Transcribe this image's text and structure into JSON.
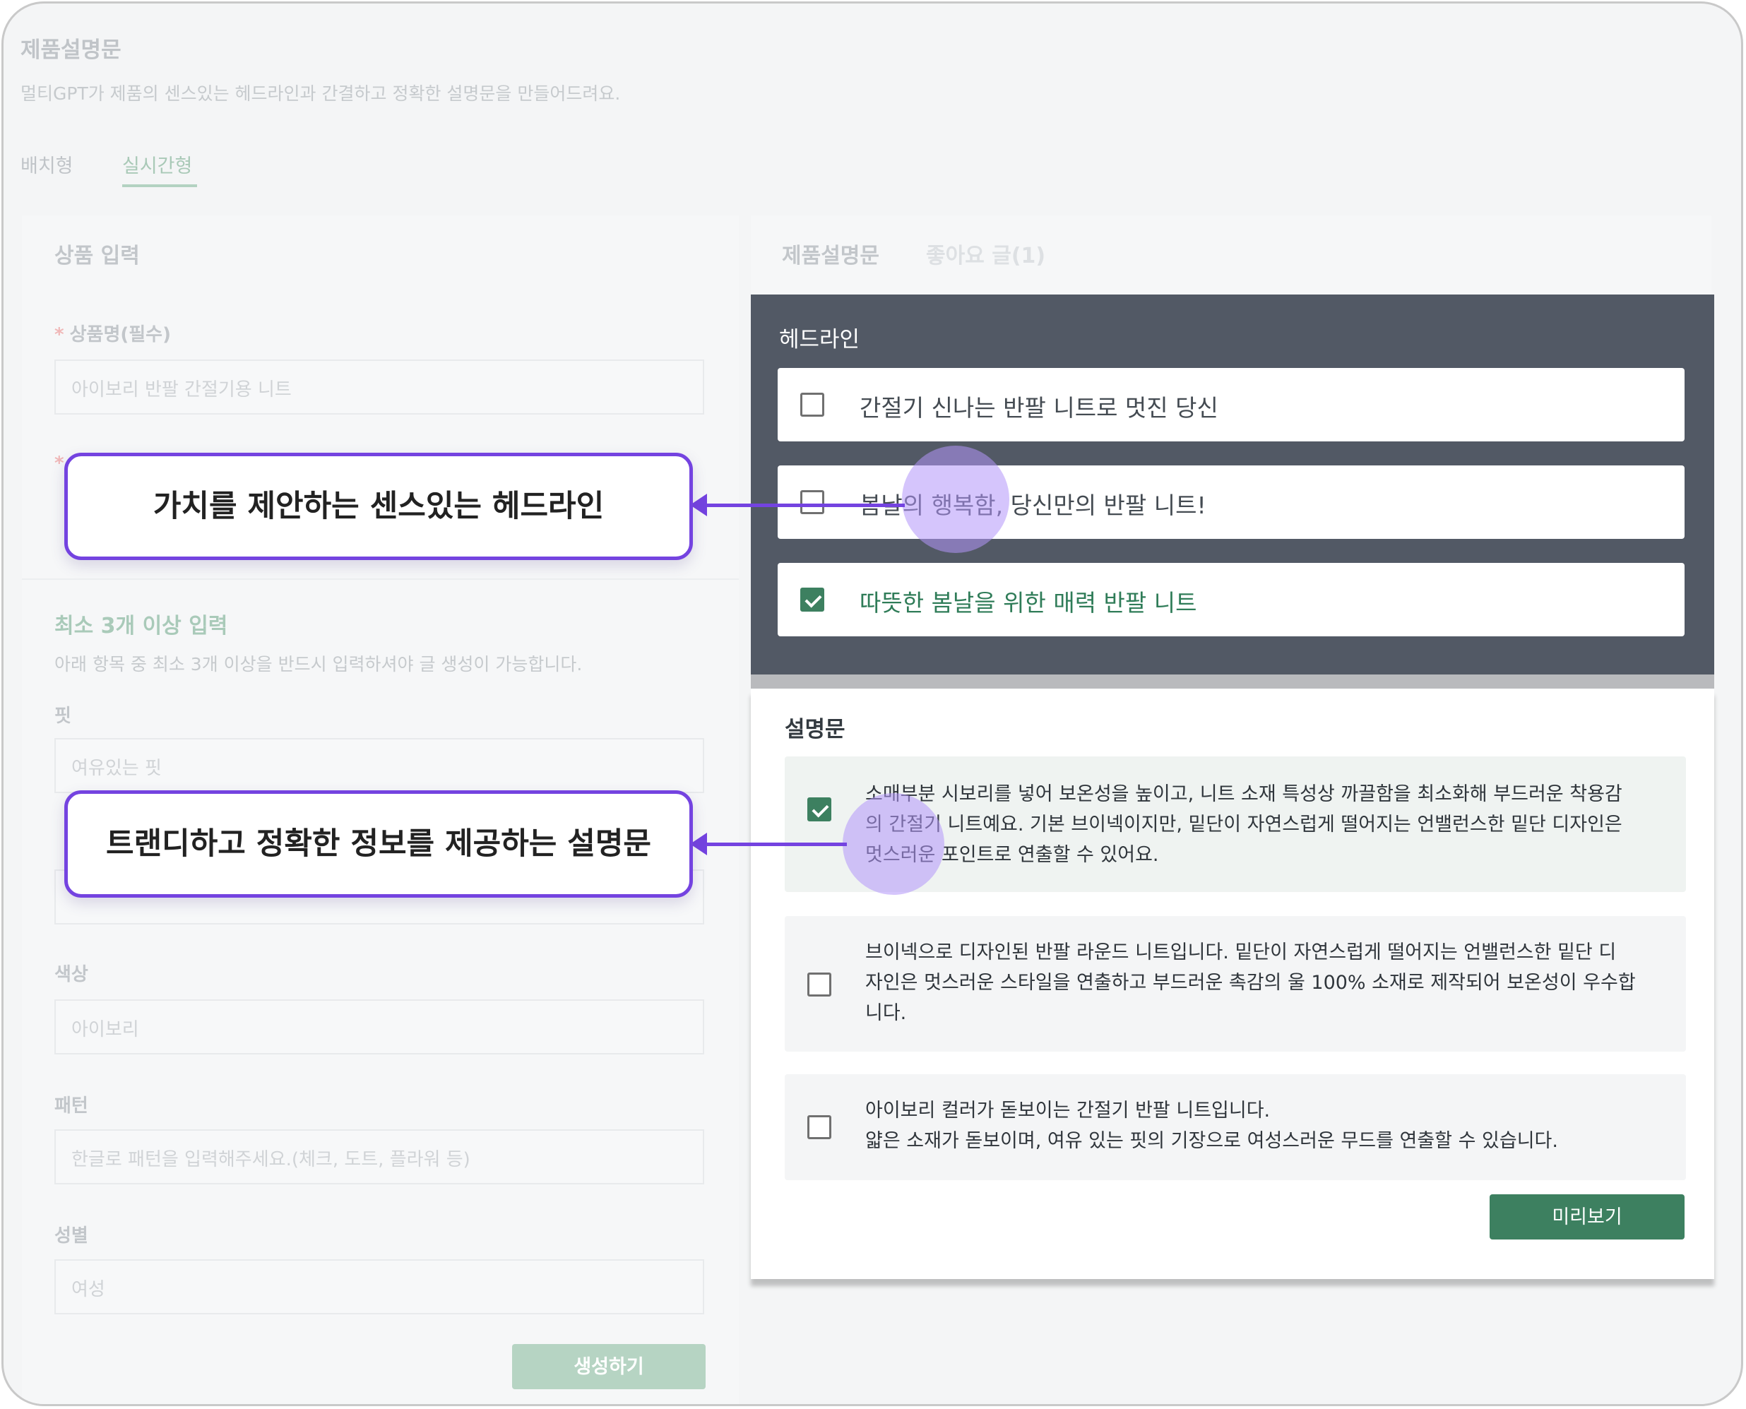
{
  "page": {
    "title": "제품설명문",
    "description": "멀티GPT가 제품의 센스있는 헤드라인과 간결하고 정확한 설명문을 만들어드려요.",
    "tabs": [
      "배치형",
      "실시간형"
    ]
  },
  "form": {
    "title": "상품 입력",
    "product_name_label": "상품명(필수)",
    "product_name_value": "아이보리 반팔 간절기용 니트",
    "section_title": "최소 3개 이상 입력",
    "section_desc": "아래 항목 중 최소 3개 이상을 반드시 입력하셔야 글 생성이 가능합니다.",
    "fit_label": "핏",
    "fit_value": "여유있는 핏",
    "color_label": "색상",
    "color_value": "아이보리",
    "pattern_label": "패턴",
    "pattern_placeholder": "한글로 패턴을 입력해주세요.(체크, 도트, 플라워 등)",
    "gender_label": "성별",
    "gender_value": "여성",
    "generate_button": "생성하기"
  },
  "result": {
    "tabs": [
      "제품설명문",
      "좋아요 글(1)"
    ],
    "headline_title": "헤드라인",
    "headlines": [
      {
        "text": "간절기 신나는 반팔 니트로 멋진 당신",
        "checked": false
      },
      {
        "text": "봄날의 행복함, 당신만의 반팔 니트!",
        "checked": false
      },
      {
        "text": "따뜻한 봄날을 위한 매력 반팔 니트",
        "checked": true
      }
    ],
    "description_title": "설명문",
    "descriptions": [
      {
        "lines": [
          "소매부분 시보리를 넣어 보온성을 높이고, 니트 소재 특성상 까끌함을 최소화해 부드러운 착용감",
          "의 간절기 니트예요. 기본 브이넥이지만, 밑단이 자연스럽게 떨어지는 언밸런스한 밑단 디자인은",
          "멋스러운 포인트로 연출할 수 있어요."
        ],
        "checked": true
      },
      {
        "lines": [
          "브이넥으로 디자인된 반팔 라운드 니트입니다. 밑단이 자연스럽게 떨어지는 언밸런스한 밑단 디",
          "자인은 멋스러운 스타일을 연출하고 부드러운 촉감의 울 100% 소재로 제작되어 보온성이 우수합",
          "니다."
        ],
        "checked": false
      },
      {
        "lines": [
          "아이보리 컬러가 돋보이는 간절기 반팔 니트입니다.",
          "얇은 소재가 돋보이며, 여유 있는 핏의 기장으로 여성스러운 무드를 연출할 수 있습니다."
        ],
        "checked": false
      }
    ],
    "preview_button": "미리보기"
  },
  "callouts": {
    "headline": "가치를 제안하는 센스있는 헤드라인",
    "description": "트랜디하고 정확한 정보를 제공하는 설명문"
  },
  "colors": {
    "accent_purple": "#7443e0",
    "brand_green": "#3d8060",
    "headline_panel": "#525965"
  }
}
